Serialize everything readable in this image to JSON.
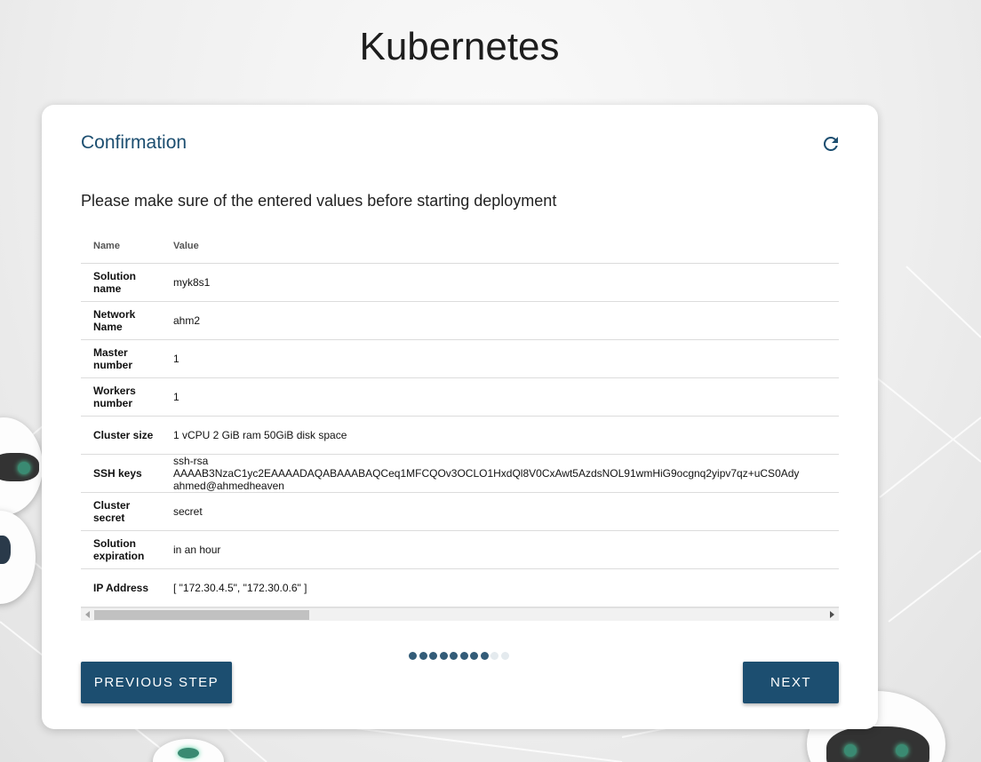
{
  "page": {
    "title": "Kubernetes"
  },
  "card": {
    "title": "Confirmation",
    "subtitle": "Please make sure of the entered values before starting deployment"
  },
  "table": {
    "headers": {
      "name": "Name",
      "value": "Value"
    },
    "rows": [
      {
        "name": "Solution name",
        "value": [
          "myk8s1"
        ]
      },
      {
        "name": "Network Name",
        "value": [
          "ahm2"
        ]
      },
      {
        "name": "Master number",
        "value": [
          "1"
        ]
      },
      {
        "name": "Workers number",
        "value": [
          "1"
        ]
      },
      {
        "name": "Cluster size",
        "value": [
          "1 vCPU 2 GiB ram 50GiB disk space"
        ]
      },
      {
        "name": "SSH keys",
        "value": [
          "ssh-rsa",
          "AAAAB3NzaC1yc2EAAAADAQABAAABAQCeq1MFCQOv3OCLO1HxdQl8V0CxAwt5AzdsNOL91wmHiG9ocgnq2yipv7qz+uCS0Ady",
          "ahmed@ahmedheaven"
        ]
      },
      {
        "name": "Cluster secret",
        "value": [
          "secret"
        ]
      },
      {
        "name": "Solution expiration",
        "value": [
          "in an hour"
        ]
      },
      {
        "name": "IP Address",
        "value": [
          "[ \"172.30.4.5\", \"172.30.0.6\" ]"
        ]
      }
    ]
  },
  "stepper": {
    "total_steps": 10,
    "current_step": 8
  },
  "buttons": {
    "previous": "PREVIOUS STEP",
    "next": "NEXT"
  },
  "colors": {
    "primary": "#1c4e70",
    "dot_active": "#335c78",
    "dot_inactive": "#e4eaee"
  }
}
